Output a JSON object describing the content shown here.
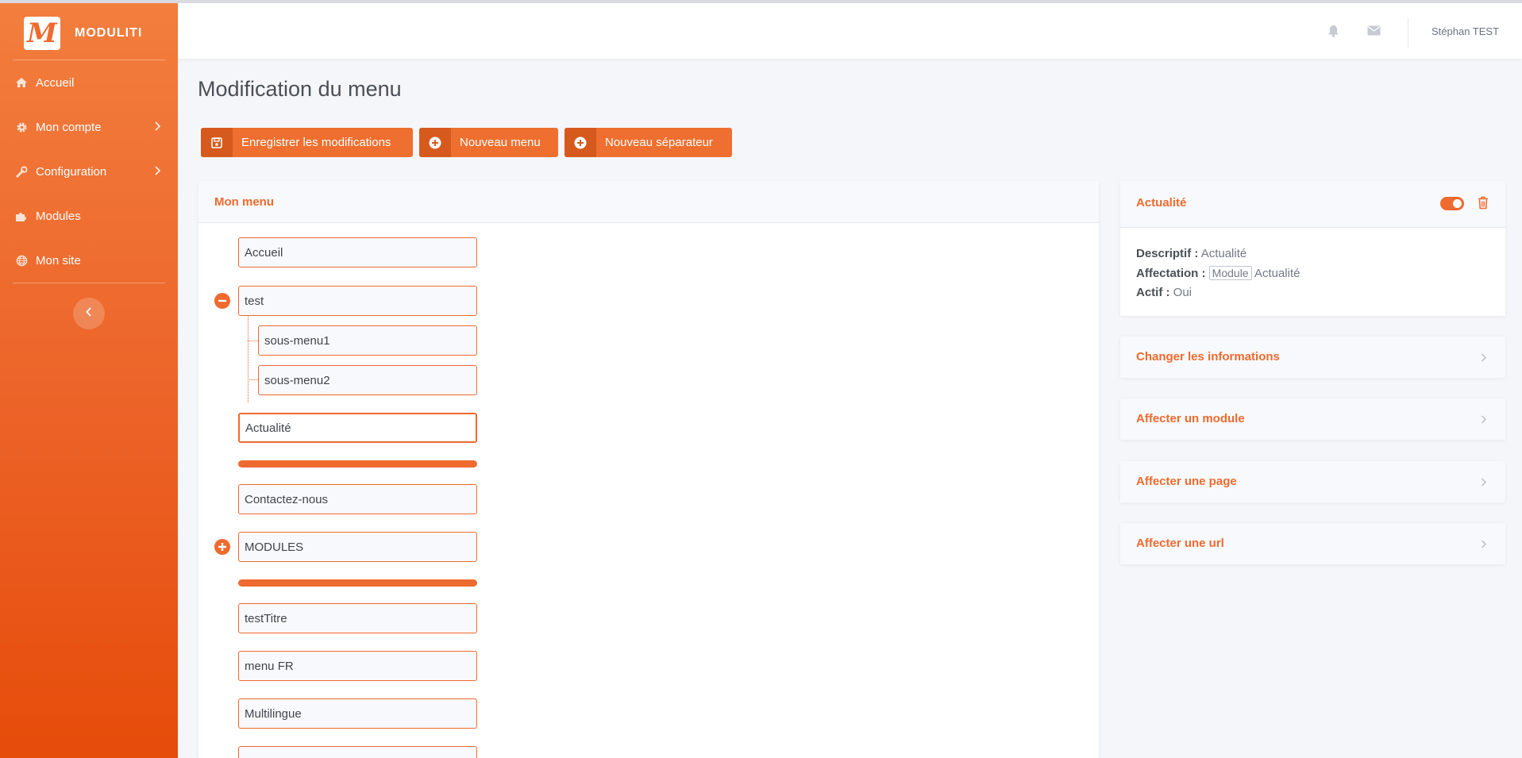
{
  "brand": {
    "name": "MODULITI",
    "logo_letter": "M"
  },
  "sidebar": {
    "items": [
      {
        "label": "Accueil",
        "icon": "home-icon"
      },
      {
        "label": "Mon compte",
        "icon": "gear-icon",
        "has_submenu": true
      },
      {
        "label": "Configuration",
        "icon": "wrench-icon",
        "has_submenu": true
      },
      {
        "label": "Modules",
        "icon": "puzzle-icon"
      },
      {
        "label": "Mon site",
        "icon": "globe-icon"
      }
    ]
  },
  "topbar": {
    "user_name": "Stéphan TEST",
    "icons": [
      "bell-icon",
      "envelope-icon"
    ]
  },
  "page": {
    "title": "Modification du menu"
  },
  "actions": {
    "save_label": "Enregistrer les modifications",
    "new_menu_label": "Nouveau menu",
    "new_separator_label": "Nouveau séparateur"
  },
  "menu_card": {
    "title": "Mon menu",
    "items": [
      {
        "label": "Accueil"
      },
      {
        "label": "test",
        "expanded": true
      },
      {
        "label": "sous-menu1"
      },
      {
        "label": "sous-menu2"
      },
      {
        "label": "Actualité",
        "selected": true
      },
      {
        "label": "Contactez-nous"
      },
      {
        "label": "MODULES",
        "collapsed": true
      },
      {
        "label": "testTitre"
      },
      {
        "label": "menu FR"
      },
      {
        "label": "Multilingue"
      }
    ]
  },
  "detail": {
    "title": "Actualité",
    "descriptif_label": "Descriptif :",
    "descriptif_value": "Actualité",
    "affectation_label": "Affectation :",
    "affectation_badge": "Module",
    "affectation_value": "Actualité",
    "actif_label": "Actif :",
    "actif_value": "Oui",
    "active_toggle": true
  },
  "accordions": [
    {
      "label": "Changer les informations"
    },
    {
      "label": "Affecter un module"
    },
    {
      "label": "Affecter une page"
    },
    {
      "label": "Affecter une url"
    }
  ],
  "colors": {
    "accent": "#ee6a2e",
    "accent_dark": "#d65a1d",
    "background": "#f5f6fa"
  }
}
